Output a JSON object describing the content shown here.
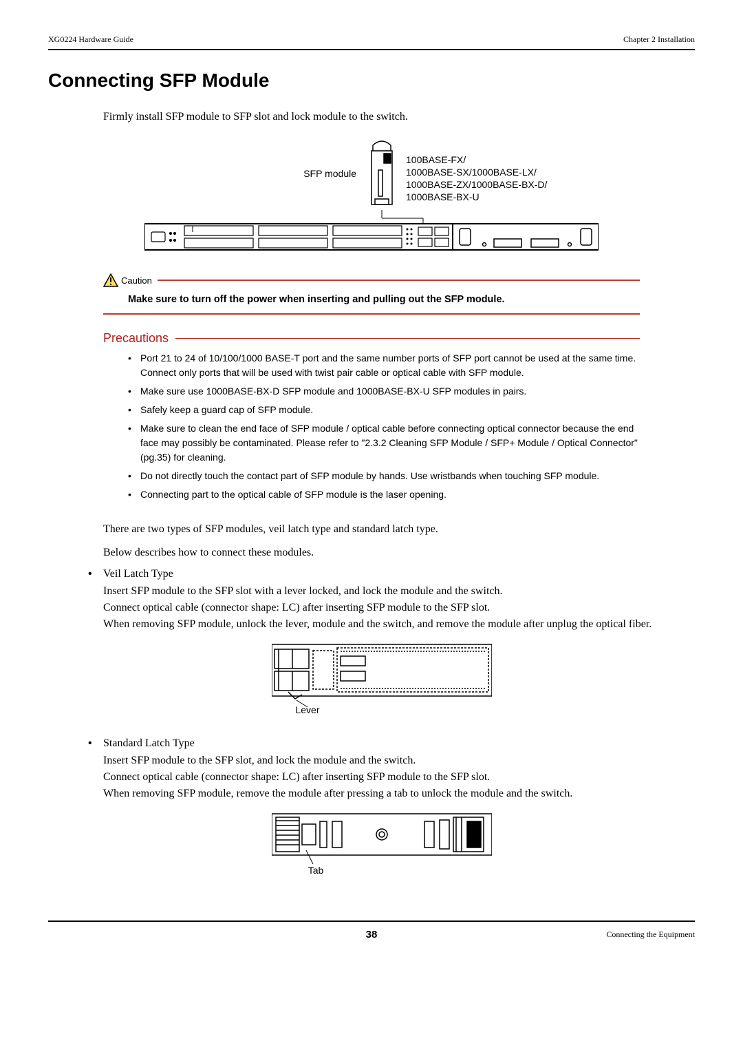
{
  "header": {
    "left": "XG0224 Hardware Guide",
    "right": "Chapter 2 Installation"
  },
  "title": "Connecting SFP Module",
  "intro": "Firmly install SFP module to SFP slot and lock module to the switch.",
  "fig1": {
    "sfp_label": "SFP module",
    "standards": "100BASE-FX/\n1000BASE-SX/1000BASE-LX/\n1000BASE-ZX/1000BASE-BX-D/\n1000BASE-BX-U"
  },
  "caution": {
    "label": "Caution",
    "text": "Make sure to turn off the power when inserting and pulling out the SFP module."
  },
  "precautions": {
    "label": "Precautions",
    "items": [
      "Port 21 to 24 of 10/100/1000 BASE-T port and the same number ports of SFP port cannot be used at the same time. Connect only ports that will be used with twist pair cable or optical cable with SFP module.",
      "Make sure use 1000BASE-BX-D SFP module and 1000BASE-BX-U SFP modules in pairs.",
      "Safely keep a guard cap of SFP module.",
      "Make sure to clean the end face of SFP module / optical cable before connecting optical connector because the end face may possibly be contaminated. Please refer to \"2.3.2 Cleaning SFP Module / SFP+ Module / Optical Connector\" (pg.35) for cleaning.",
      "Do not directly touch the contact part of SFP module by hands. Use wristbands when touching SFP module.",
      "Connecting part to the optical cable of SFP module is the laser opening."
    ]
  },
  "para1": "There are two types of SFP modules, veil latch type and standard latch type.",
  "para2": "Below describes how to connect these modules.",
  "types": [
    {
      "name": "Veil Latch Type",
      "body": "Insert SFP module to the SFP slot with a lever locked, and lock the module and the switch.\nConnect optical cable (connector shape: LC) after inserting SFP module to the SFP slot.\nWhen removing SFP module, unlock the lever, module and the switch, and remove the module after unplug the optical fiber.",
      "callout": "Lever"
    },
    {
      "name": "Standard Latch Type",
      "body": "Insert SFP module to the SFP slot, and lock the module and the switch.\nConnect optical cable (connector shape: LC) after inserting SFP module to the SFP slot.\nWhen removing SFP module, remove the module after pressing a tab to unlock the module and the switch.",
      "callout": "Tab"
    }
  ],
  "footer": {
    "page": "38",
    "right": "Connecting the Equipment"
  }
}
